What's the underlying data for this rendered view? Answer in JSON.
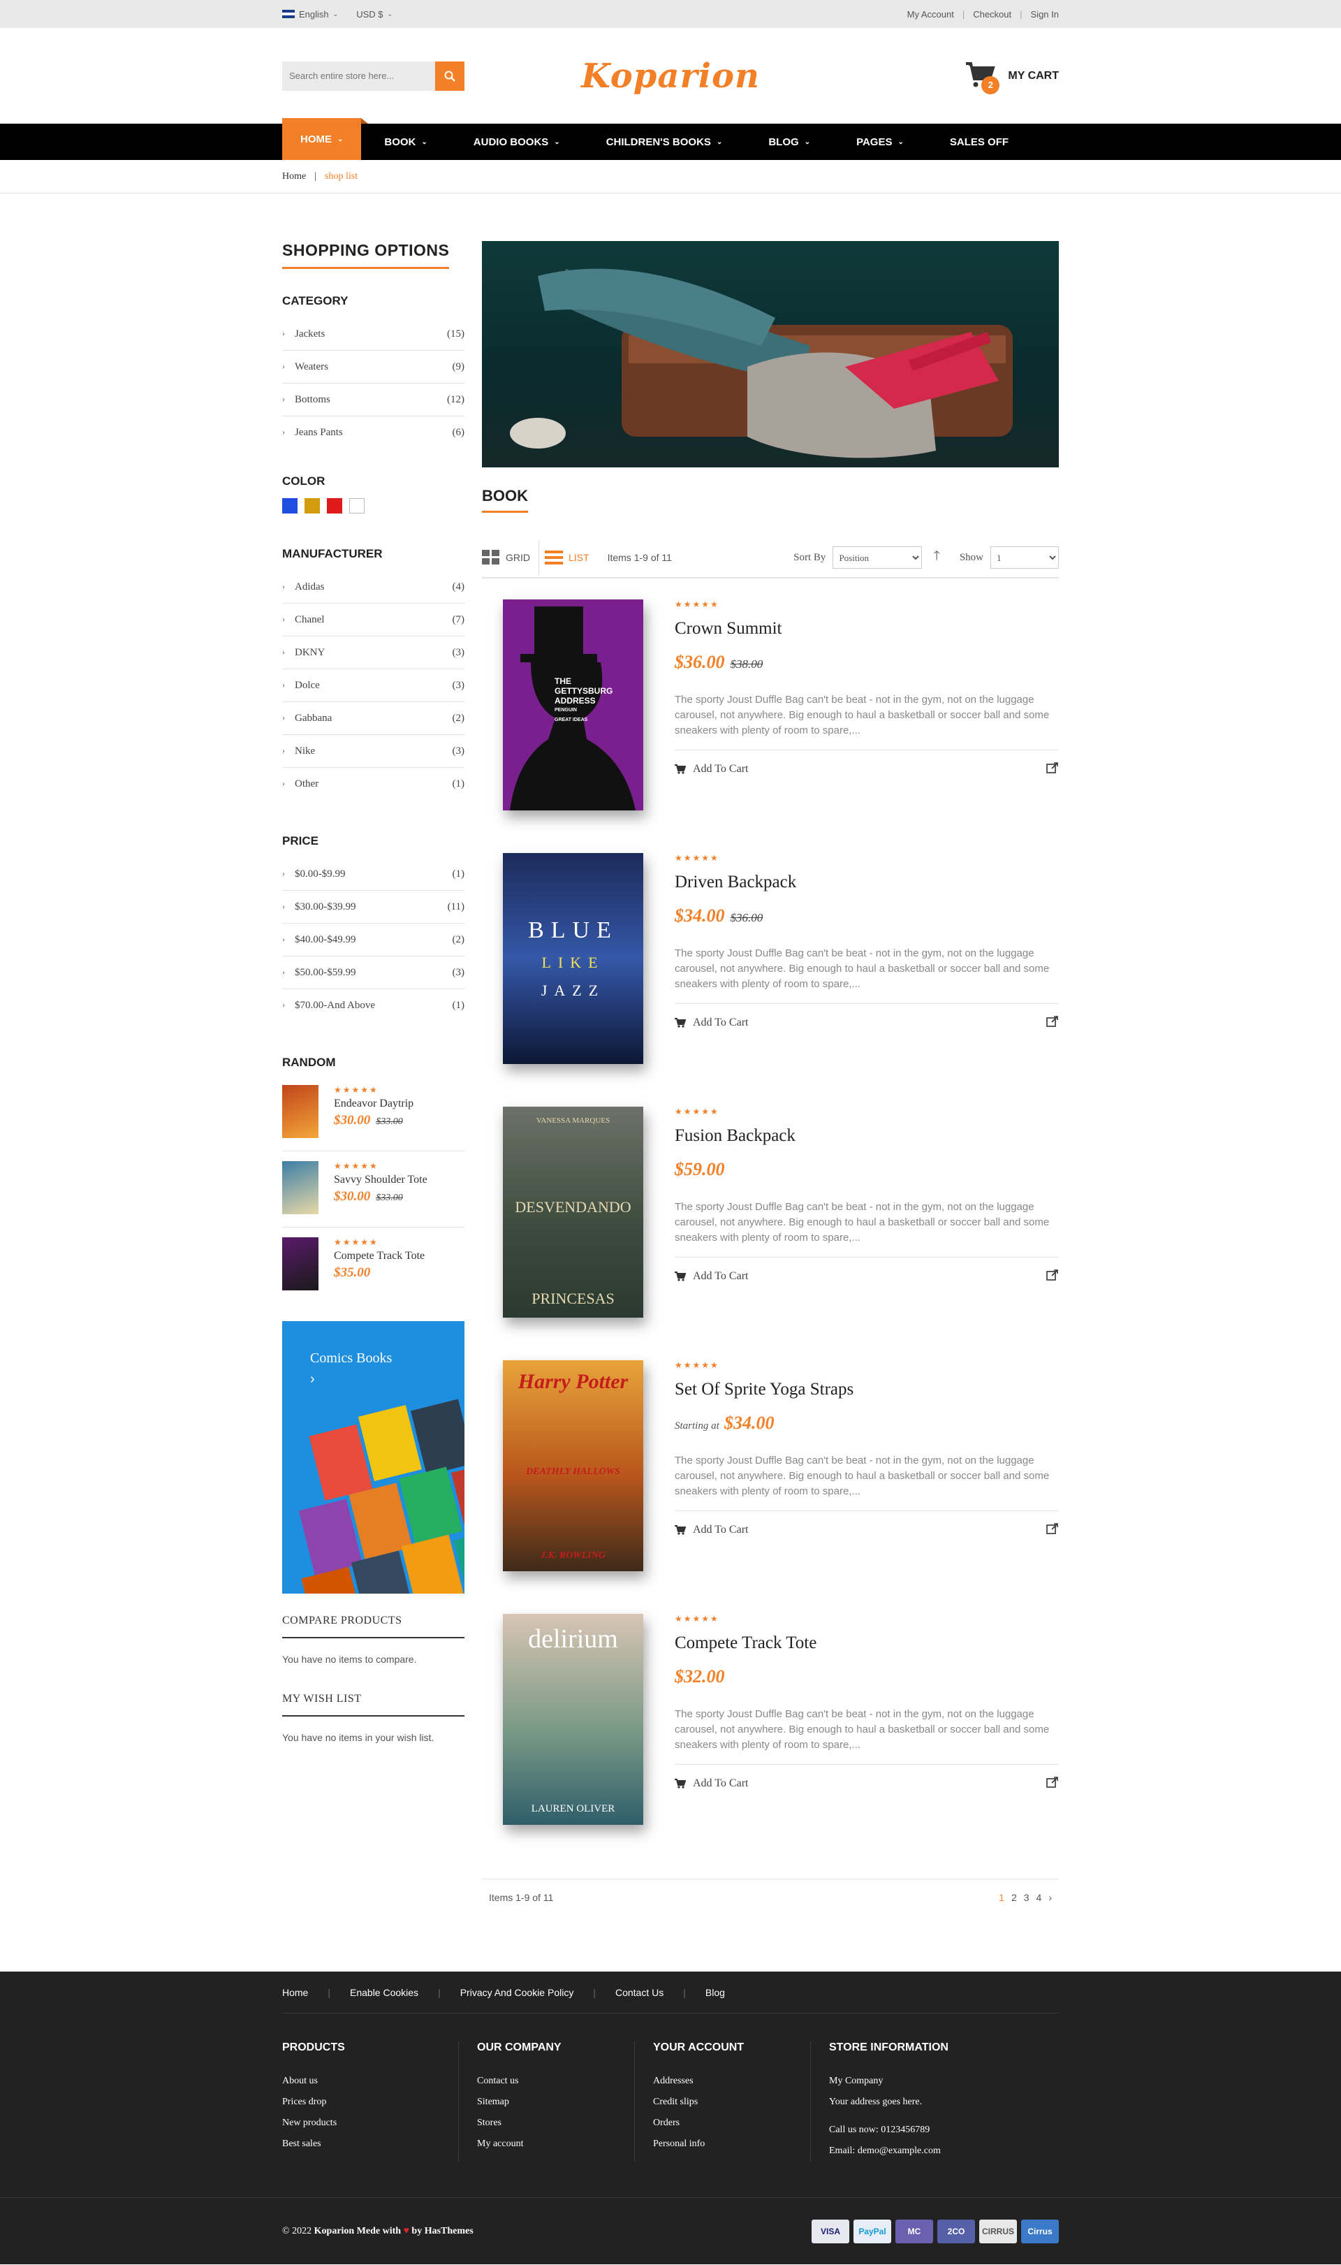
{
  "topbar": {
    "language": "English",
    "currency": "USD $",
    "links": [
      "My Account",
      "Checkout",
      "Sign In"
    ]
  },
  "header": {
    "search_placeholder": "Search entire store here...",
    "logo": "Koparion",
    "cart_label": "MY CART",
    "cart_count": "2"
  },
  "nav": {
    "items": [
      "HOME",
      "BOOK",
      "AUDIO BOOKS",
      "CHILDREN'S BOOKS",
      "BLOG",
      "PAGES",
      "SALES OFF"
    ]
  },
  "breadcrumb": {
    "home": "Home",
    "current": "shop list"
  },
  "sidebar": {
    "title": "SHOPPING OPTIONS",
    "category_h": "CATEGORY",
    "categories": [
      {
        "label": "Jackets",
        "count": "(15)"
      },
      {
        "label": "Weaters",
        "count": "(9)"
      },
      {
        "label": "Bottoms",
        "count": "(12)"
      },
      {
        "label": "Jeans Pants",
        "count": "(6)"
      }
    ],
    "color_h": "COLOR",
    "colors": [
      "#1e4fe0",
      "#d39b0f",
      "#e01a1a",
      "#ffffff"
    ],
    "manufacturer_h": "MANUFACTURER",
    "manufacturers": [
      {
        "label": "Adidas",
        "count": "(4)"
      },
      {
        "label": "Chanel",
        "count": "(7)"
      },
      {
        "label": "DKNY",
        "count": "(3)"
      },
      {
        "label": "Dolce",
        "count": "(3)"
      },
      {
        "label": "Gabbana",
        "count": "(2)"
      },
      {
        "label": "Nike",
        "count": "(3)"
      },
      {
        "label": "Other",
        "count": "(1)"
      }
    ],
    "price_h": "PRICE",
    "prices": [
      {
        "label": "$0.00-$9.99",
        "count": "(1)"
      },
      {
        "label": "$30.00-$39.99",
        "count": "(11)"
      },
      {
        "label": "$40.00-$49.99",
        "count": "(2)"
      },
      {
        "label": "$50.00-$59.99",
        "count": "(3)"
      },
      {
        "label": "$70.00-And Above",
        "count": "(1)"
      }
    ],
    "random_h": "RANDOM",
    "random": [
      {
        "name": "Endeavor Daytrip",
        "price": "$30.00",
        "old": "$33.00"
      },
      {
        "name": "Savvy Shoulder Tote",
        "price": "$30.00",
        "old": "$33.00"
      },
      {
        "name": "Compete Track Tote",
        "price": "$35.00",
        "old": ""
      }
    ],
    "banner_title": "Comics Books",
    "compare_h": "COMPARE PRODUCTS",
    "compare_t": "You have no items to compare.",
    "wish_h": "MY WISH LIST",
    "wish_t": "You have no items in your wish list."
  },
  "content": {
    "category_title": "BOOK",
    "grid_label": "GRID",
    "list_label": "LIST",
    "items_text": "Items 1-9 of 11",
    "sort_label": "Sort By",
    "sort_value": "Position",
    "show_label": "Show",
    "show_value": "1",
    "products": [
      {
        "name": "Crown Summit",
        "start": "",
        "price": "$36.00",
        "old": "$38.00",
        "cover": "abe"
      },
      {
        "name": "Driven Backpack",
        "start": "",
        "price": "$34.00",
        "old": "$36.00",
        "cover": "blue"
      },
      {
        "name": "Fusion Backpack",
        "start": "",
        "price": "$59.00",
        "old": "",
        "cover": "princesas"
      },
      {
        "name": "Set Of Sprite Yoga Straps",
        "start": "Starting at",
        "price": "$34.00",
        "old": "",
        "cover": "potter"
      },
      {
        "name": "Compete Track Tote",
        "start": "",
        "price": "$32.00",
        "old": "",
        "cover": "delirium"
      }
    ],
    "description": "The sporty Joust Duffle Bag can't be beat - not in the gym, not on the luggage carousel, not anywhere. Big enough to haul a basketball or soccer ball and some sneakers with plenty of room to spare,...",
    "add_to_cart": "Add To Cart",
    "pages": [
      "1",
      "2",
      "3",
      "4",
      "›"
    ]
  },
  "covers": {
    "abe": {
      "lines": [
        "THE",
        "GETTYSBURG",
        "ADDRESS",
        "PENGUIN",
        "GREAT IDEAS"
      ]
    },
    "blue": {
      "lines": [
        "BLUE",
        "LIKE",
        "JAZZ"
      ]
    },
    "princesas": {
      "lines": [
        "VANESSA MARQUES",
        "DESVENDANDO",
        "PRINCESAS"
      ]
    },
    "potter": {
      "lines": [
        "Harry Potter",
        "DEATHLY HALLOWS",
        "J.K. ROWLING"
      ]
    },
    "delirium": {
      "lines": [
        "delirium",
        "LAUREN OLIVER"
      ]
    }
  },
  "footer": {
    "links": [
      "Home",
      "Enable Cookies",
      "Privacy And Cookie Policy",
      "Contact Us",
      "Blog"
    ],
    "columns": [
      {
        "title": "PRODUCTS",
        "items": [
          "About us",
          "Prices drop",
          "New products",
          "Best sales"
        ]
      },
      {
        "title": "OUR COMPANY",
        "items": [
          "Contact us",
          "Sitemap",
          "Stores",
          "My account"
        ]
      },
      {
        "title": "YOUR ACCOUNT",
        "items": [
          "Addresses",
          "Credit slips",
          "Orders",
          "Personal info"
        ]
      },
      {
        "title": "STORE INFORMATION",
        "items": [
          "My Company",
          "Your address goes here.",
          "Call us now: 0123456789",
          "Email: demo@example.com"
        ]
      }
    ],
    "copy_pre": "© 2022",
    "copy_brand": "Koparion",
    "copy_mid": "Mede with",
    "copy_by": "by",
    "copy_author": "HasThemes",
    "payments": [
      "VISA",
      "PayPal",
      "MC",
      "2CO",
      "CIRRUS",
      "Cirrus"
    ]
  }
}
